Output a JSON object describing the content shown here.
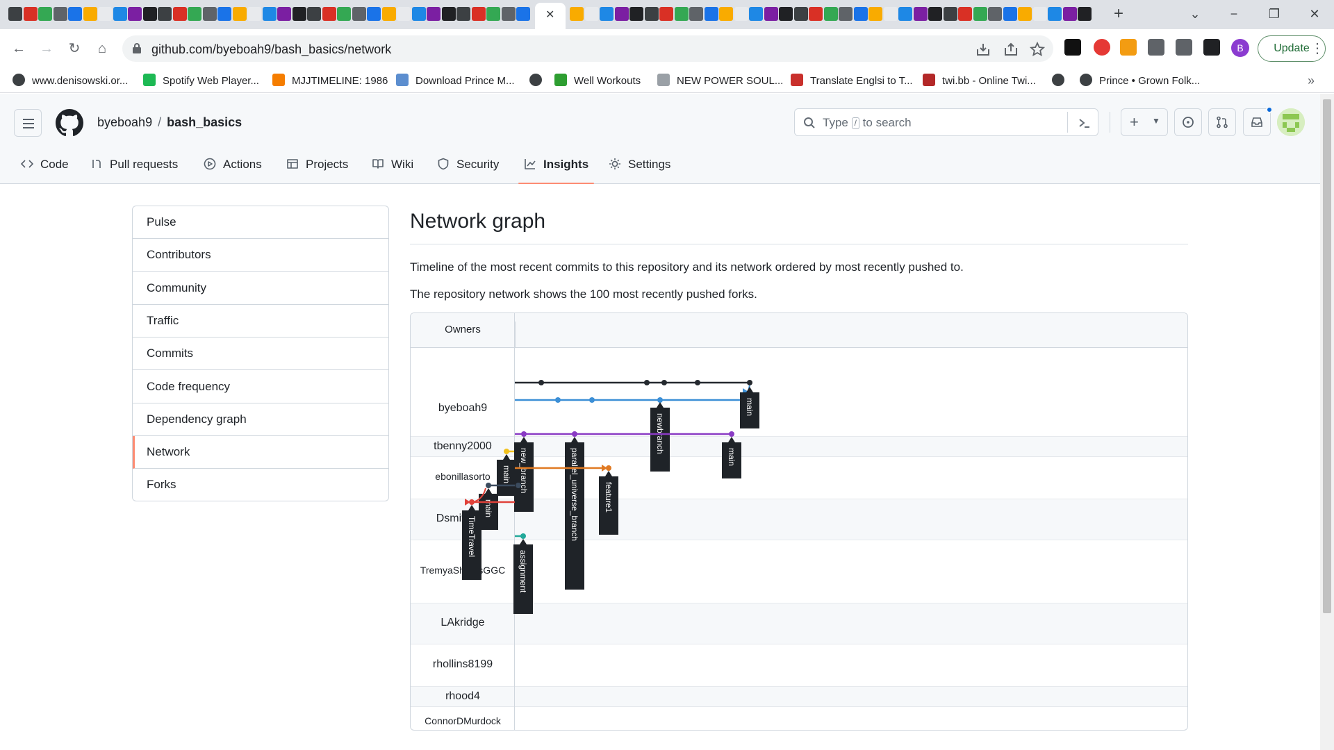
{
  "browser": {
    "url": "github.com/byeboah9/bash_basics/network",
    "update_label": "Update",
    "profile_initial": "B",
    "bookmarks": [
      {
        "label": "www.denisowski.or...",
        "color": "#3c4043"
      },
      {
        "label": "Spotify Web Player...",
        "color": "#1db954"
      },
      {
        "label": "MJJTIMELINE: 1986",
        "color": "#f57d00"
      },
      {
        "label": "Download Prince M...",
        "color": "#5c8ecf"
      },
      {
        "label": "",
        "color": "#3c4043"
      },
      {
        "label": "Well Workouts",
        "color": "#2e9e31"
      },
      {
        "label": "NEW POWER SOUL...",
        "color": "#9aa0a6"
      },
      {
        "label": "Translate Englsi to T...",
        "color": "#c9302c"
      },
      {
        "label": "twi.bb - Online Twi...",
        "color": "#b32828"
      },
      {
        "label": "",
        "color": "#3c4043"
      },
      {
        "label": "Prince • Grown Folk...",
        "color": "#3c4043"
      }
    ]
  },
  "header": {
    "owner": "byeboah9",
    "separator": "/",
    "repo": "bash_basics",
    "search_prefix": "Type",
    "search_key": "/",
    "search_suffix": "to search"
  },
  "repo_nav": [
    {
      "label": "Code",
      "icon": "code-icon"
    },
    {
      "label": "Pull requests",
      "icon": "pull-request-icon"
    },
    {
      "label": "Actions",
      "icon": "play-icon"
    },
    {
      "label": "Projects",
      "icon": "table-icon"
    },
    {
      "label": "Wiki",
      "icon": "book-icon"
    },
    {
      "label": "Security",
      "icon": "shield-icon"
    },
    {
      "label": "Insights",
      "icon": "graph-icon",
      "selected": true
    },
    {
      "label": "Settings",
      "icon": "gear-icon"
    }
  ],
  "sidebar": [
    {
      "label": "Pulse"
    },
    {
      "label": "Contributors"
    },
    {
      "label": "Community"
    },
    {
      "label": "Traffic"
    },
    {
      "label": "Commits"
    },
    {
      "label": "Code frequency"
    },
    {
      "label": "Dependency graph"
    },
    {
      "label": "Network",
      "selected": true
    },
    {
      "label": "Forks"
    }
  ],
  "main": {
    "title": "Network graph",
    "description1": "Timeline of the most recent commits to this repository and its network ordered by most recently pushed to.",
    "description2": "The repository network shows the 100 most recently pushed forks."
  },
  "network": {
    "owners_header": "Owners",
    "owners": [
      "byeboah9",
      "tbenny2000",
      "ebonillasorto",
      "Dsmith831",
      "TremyaSheatsGGC",
      "LAkridge",
      "rhollins8199",
      "rhood4",
      "ConnorDMurdock"
    ],
    "colors": {
      "black": "#24292f",
      "blue": "#3c8fd6",
      "purple": "#8a3bc4",
      "yellow": "#f2c11d",
      "orange": "#e07a23",
      "slate": "#3b4b5e",
      "red": "#e0423a",
      "teal": "#22a99a"
    },
    "branch_labels": [
      "main",
      "newbranch",
      "main",
      "main",
      "new_branch",
      "parallel_universe_branch",
      "feature1",
      "main",
      "TimeTravel",
      "assignment"
    ]
  }
}
